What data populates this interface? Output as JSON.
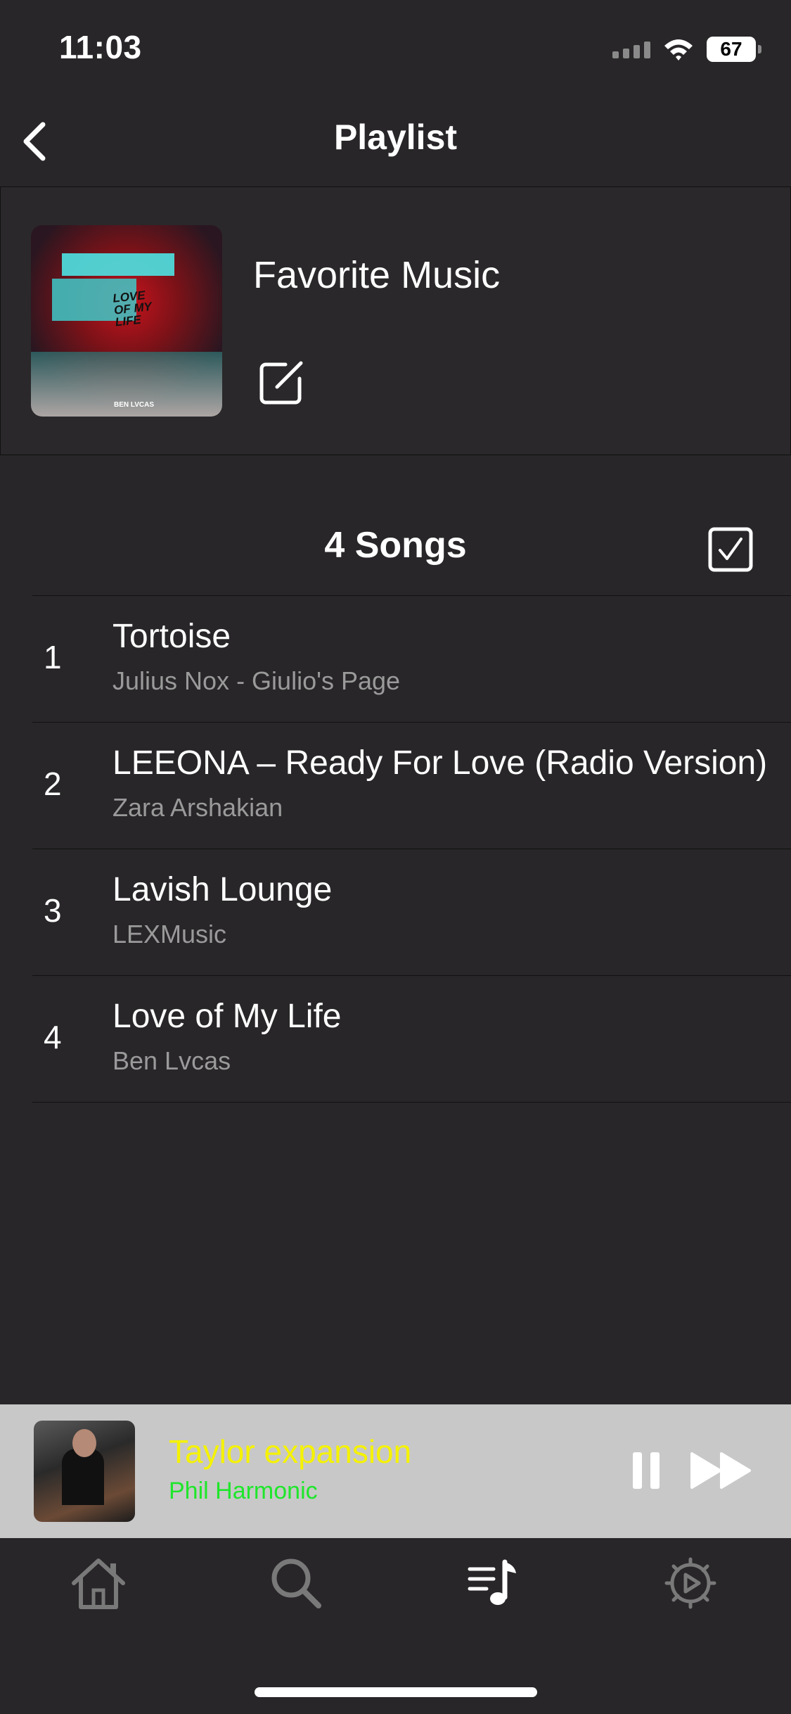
{
  "status_bar": {
    "time": "11:03",
    "battery": "67"
  },
  "nav": {
    "title": "Playlist"
  },
  "playlist": {
    "name": "Favorite Music",
    "cover_text": "LOVE OF MY LIFE",
    "cover_artist": "BEN LVCAS"
  },
  "songs_header": {
    "count_label": "4 Songs"
  },
  "songs": [
    {
      "number": "1",
      "title": "Tortoise",
      "artist": "Julius Nox - Giulio's Page"
    },
    {
      "number": "2",
      "title": "LEEONA – Ready For Love (Radio Version)",
      "artist": "Zara Arshakian"
    },
    {
      "number": "3",
      "title": "Lavish Lounge",
      "artist": "LEXMusic"
    },
    {
      "number": "4",
      "title": "Love of My Life",
      "artist": "Ben Lvcas"
    }
  ],
  "now_playing": {
    "title": "Taylor expansion",
    "artist": "Phil Harmonic",
    "title_color": "#f5f200",
    "artist_color": "#1fe62b"
  },
  "tabs": [
    {
      "icon": "home-icon",
      "active": false
    },
    {
      "icon": "search-icon",
      "active": false
    },
    {
      "icon": "playlist-icon",
      "active": true
    },
    {
      "icon": "settings-icon",
      "active": false
    }
  ],
  "colors": {
    "background": "#282628",
    "player_bg": "#c8c8c8",
    "secondary_text": "#9b9a9b"
  }
}
